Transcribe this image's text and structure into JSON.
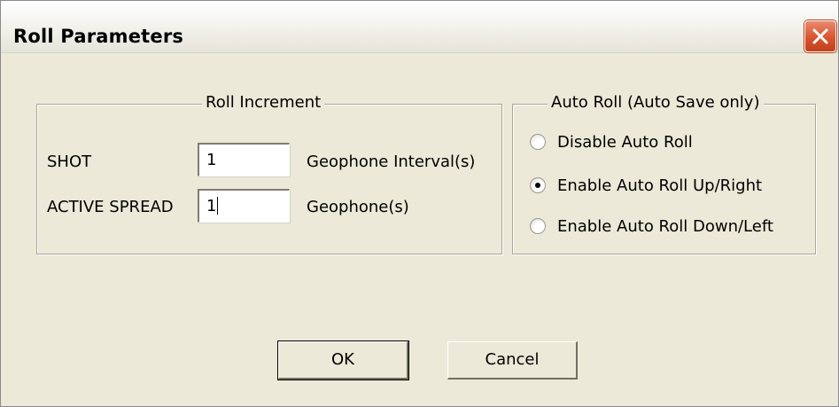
{
  "window": {
    "title": "Roll Parameters"
  },
  "roll_increment": {
    "legend": "Roll Increment",
    "shot_label": "SHOT",
    "shot_value": "1",
    "shot_unit": "Geophone Interval(s)",
    "spread_label": "ACTIVE SPREAD",
    "spread_value": "1",
    "spread_unit": "Geophone(s)"
  },
  "auto_roll": {
    "legend": "Auto Roll (Auto Save only)",
    "options": [
      {
        "label": "Disable Auto Roll",
        "selected": false
      },
      {
        "label": "Enable Auto Roll Up/Right",
        "selected": true
      },
      {
        "label": "Enable Auto Roll Down/Left",
        "selected": false
      }
    ]
  },
  "buttons": {
    "ok": "OK",
    "cancel": "Cancel"
  },
  "icons": {
    "close": "close-icon",
    "radio": "radio-button-icon"
  },
  "colors": {
    "dialog_background": "#ece9d8",
    "close_button": "#d9542e"
  }
}
